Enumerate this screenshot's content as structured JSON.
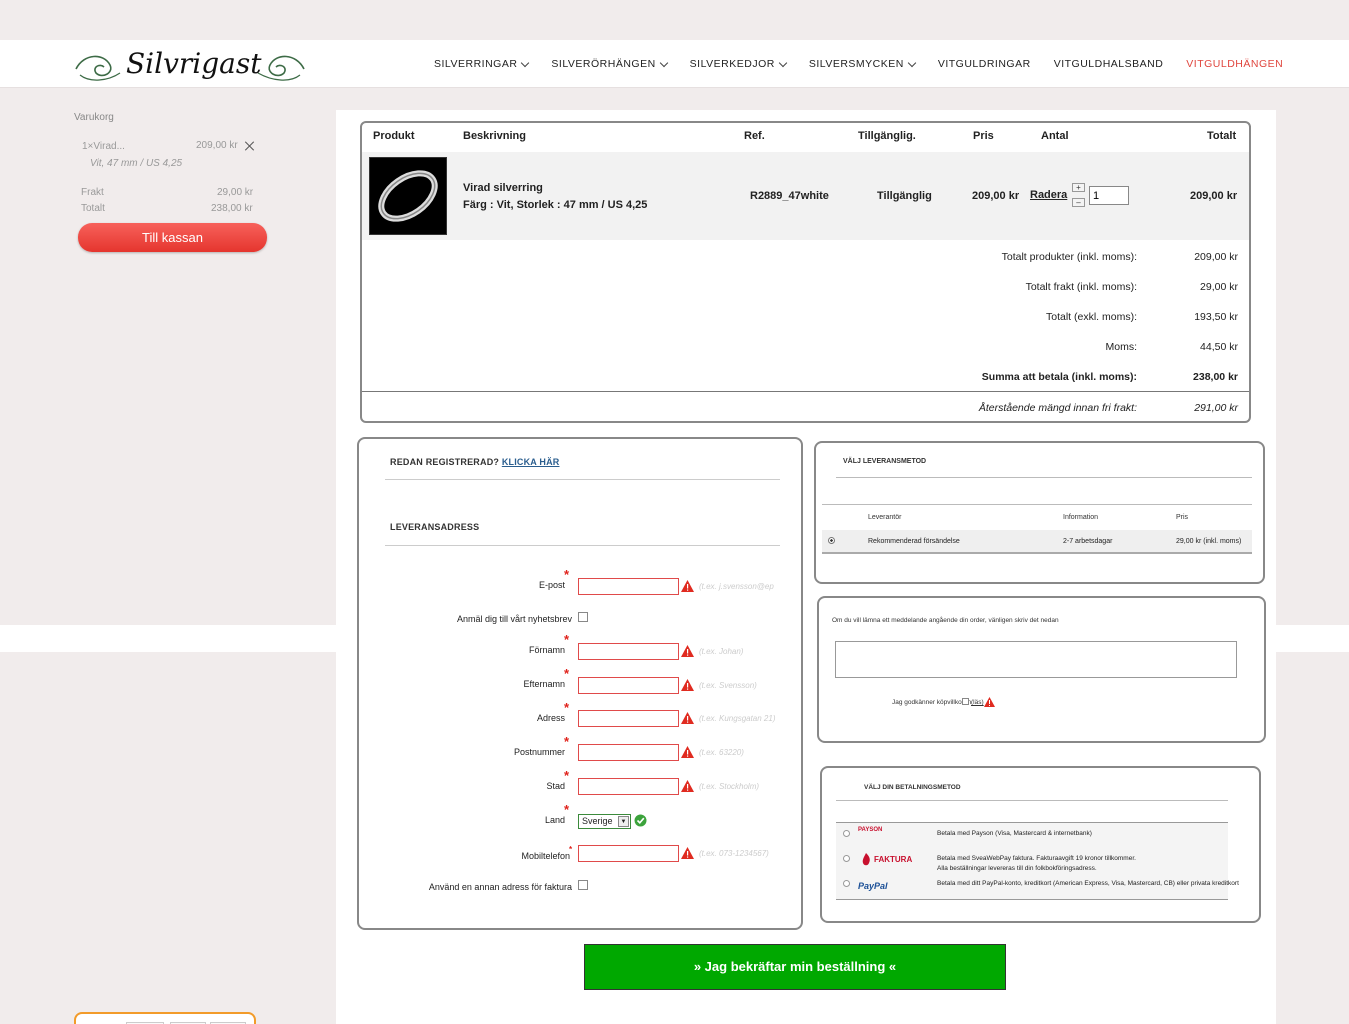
{
  "brand": {
    "logo_text": "Silvrigast"
  },
  "nav": [
    {
      "label": "SILVERRINGAR",
      "dropdown": true,
      "active": false
    },
    {
      "label": "SILVERÖRHÄNGEN",
      "dropdown": true,
      "active": false
    },
    {
      "label": "SILVERKEDJOR",
      "dropdown": true,
      "active": false
    },
    {
      "label": "SILVERSMYCKEN",
      "dropdown": true,
      "active": false
    },
    {
      "label": "VITGULDRINGAR",
      "dropdown": false,
      "active": false
    },
    {
      "label": "VITGULDHALSBAND",
      "dropdown": false,
      "active": false
    },
    {
      "label": "VITGULDHÄNGEN",
      "dropdown": false,
      "active": true
    }
  ],
  "sidebar": {
    "title": "Varukorg",
    "item_name": "1×Virad...",
    "item_price": "209,00 kr",
    "item_variant": "Vit, 47 mm / US 4,25",
    "shipping_label": "Frakt",
    "shipping_value": "29,00 kr",
    "total_label": "Totalt",
    "total_value": "238,00 kr",
    "checkout_label": "Till kassan"
  },
  "cart": {
    "headers": {
      "product": "Produkt",
      "description": "Beskrivning",
      "ref": "Ref.",
      "availability": "Tillgänglig.",
      "price": "Pris",
      "qty": "Antal",
      "total": "Totalt"
    },
    "row": {
      "name": "Virad silverring",
      "variant": "Färg : Vit, Storlek : 47 mm / US 4,25",
      "ref": "R2889_47white",
      "availability": "Tillgänglig",
      "price": "209,00 kr",
      "delete_label": "Radera",
      "qty": "1",
      "total": "209,00 kr"
    },
    "summary": [
      {
        "label": "Totalt produkter (inkl. moms):",
        "value": "209,00 kr"
      },
      {
        "label": "Totalt frakt (inkl. moms):",
        "value": "29,00 kr"
      },
      {
        "label": "Totalt (exkl. moms):",
        "value": "193,50 kr"
      },
      {
        "label": "Moms:",
        "value": "44,50 kr"
      },
      {
        "label": "Summa att betala (inkl. moms):",
        "value": "238,00 kr"
      },
      {
        "label": "Återstående mängd innan fri frakt:",
        "value": "291,00 kr"
      }
    ]
  },
  "form": {
    "registered_text": "REDAN REGISTRERAD?",
    "registered_link": "KLICKA HÄR",
    "section_title": "LEVERANSADRESS",
    "email_label": "E-post",
    "email_hint": "(t.ex. j.svensson@ep",
    "newsletter_label": "Anmäl dig till vårt nyhetsbrev",
    "firstname_label": "Förnamn",
    "firstname_hint": "(t.ex. Johan)",
    "lastname_label": "Efternamn",
    "lastname_hint": "(t.ex. Svensson)",
    "address_label": "Adress",
    "address_hint": "(t.ex. Kungsgatan 21)",
    "zip_label": "Postnummer",
    "zip_hint": "(t.ex. 63220)",
    "city_label": "Stad",
    "city_hint": "(t.ex. Stockholm)",
    "country_label": "Land",
    "country_value": "Sverige",
    "mobile_label": "Mobiltelefon",
    "mobile_hint": "(t.ex. 073-1234567)",
    "other_address_label": "Använd en annan adress för faktura"
  },
  "delivery": {
    "title": "VÄLJ LEVERANSMETOD",
    "col_provider": "Leverantör",
    "col_info": "Information",
    "col_price": "Pris",
    "provider": "Rekommenderad försändelse",
    "info": "2-7 arbetsdagar",
    "price": "29,00 kr (inkl. moms)"
  },
  "message": {
    "prompt": "Om du vill lämna ett meddelande angående din order, vänligen skriv det nedan",
    "terms_label": "Jag godkänner köpvillkoren",
    "terms_link": "(läs)"
  },
  "payment": {
    "title": "VÄLJ DIN BETALNINGSMETOD",
    "options": [
      {
        "logo": "PAYSON",
        "text": "Betala med Payson (Visa, Mastercard & internetbank)"
      },
      {
        "logo": "FAKTURA",
        "text": "Betala med SveaWebPay faktura. Fakturaavgift 19 kronor tillkommer.",
        "text2": "Alla beställningar levereras till din folkbokföringsadress."
      },
      {
        "logo": "PayPal",
        "text": "Betala med ditt PayPal-konto, kreditkort (American Express, Visa, Mastercard, CB) eller privata kreditkort"
      }
    ]
  },
  "confirm": {
    "label": "»  Jag bekräftar min beställning  «"
  },
  "colors": {
    "accent": "#e0463e",
    "confirm": "#00a800",
    "error": "#e04a4a"
  }
}
